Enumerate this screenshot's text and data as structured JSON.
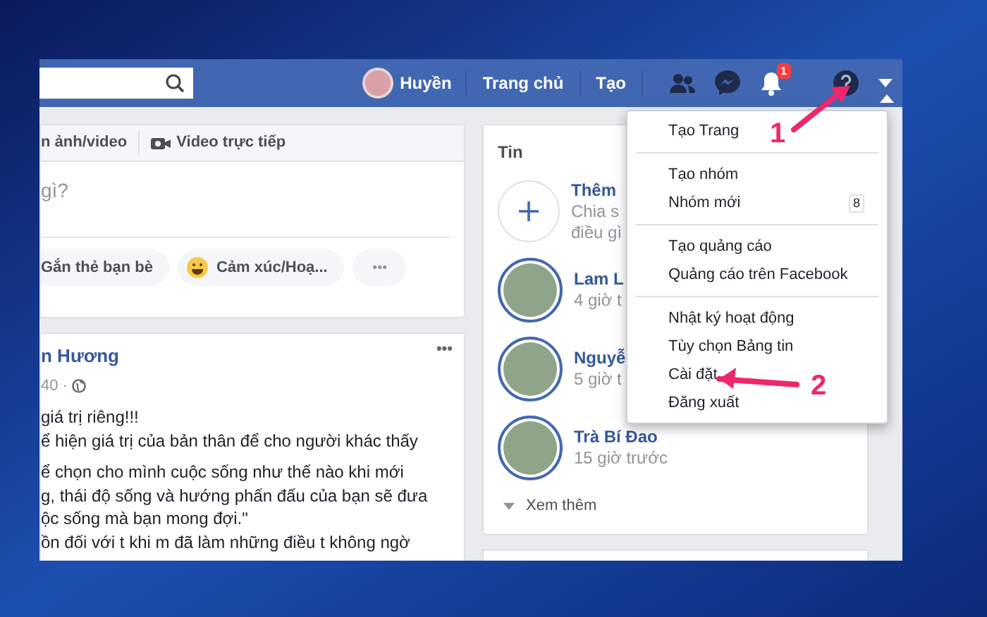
{
  "topbar": {
    "user": "Huyền",
    "nav": [
      "Trang chủ",
      "Tạo"
    ],
    "notification_count": "1",
    "menu_open": true
  },
  "composer": {
    "tabs": [
      "n ảnh/video",
      "Video trực tiếp"
    ],
    "prompt": "gì?",
    "actions": [
      {
        "kind": "tag",
        "label": "Gắn thẻ bạn bè"
      },
      {
        "kind": "feeling",
        "label": "Cảm xúc/Hoạ..."
      },
      {
        "kind": "more",
        "label": "•••"
      }
    ]
  },
  "post": {
    "author": "n Hương",
    "time": "40 ·",
    "more": "•••",
    "paragraphs": [
      [
        "giá trị riêng!!!",
        "ể hiện giá trị của bản thân để cho người khác thấy"
      ],
      [
        "ể chọn cho mình cuộc sống như thế nào khi mới",
        "g, thái độ sống và hướng phấn đấu của bạn sẽ đưa",
        "ộc sống mà bạn mong đợi.\"",
        "ồn đối với t khi m đã làm những điều t không ngờ"
      ]
    ]
  },
  "stories": {
    "title": "Tin",
    "items": [
      {
        "kind": "add",
        "name": "Thêm",
        "lines": [
          "Chia s",
          "điều gì"
        ]
      },
      {
        "kind": "story",
        "name": "Lam L",
        "lines": [
          "4 giờ t"
        ]
      },
      {
        "kind": "story",
        "name": "Nguyễ",
        "lines": [
          "5 giờ t"
        ]
      },
      {
        "kind": "story",
        "name": "Trà Bí Đao",
        "lines": [
          "15 giờ trước"
        ]
      }
    ],
    "see_more": "Xem thêm"
  },
  "menu": {
    "groups": [
      [
        {
          "label": "Tạo Trang"
        }
      ],
      [
        {
          "label": "Tạo nhóm"
        },
        {
          "label": "Nhóm mới",
          "count": "8"
        }
      ],
      [
        {
          "label": "Tạo quảng cáo"
        },
        {
          "label": "Quảng cáo trên Facebook"
        }
      ],
      [
        {
          "label": "Nhật ký hoạt động"
        },
        {
          "label": "Tùy chọn Bảng tin"
        },
        {
          "label": "Cài đặt"
        },
        {
          "label": "Đăng xuất"
        }
      ]
    ]
  },
  "annotations": [
    "1",
    "2"
  ]
}
